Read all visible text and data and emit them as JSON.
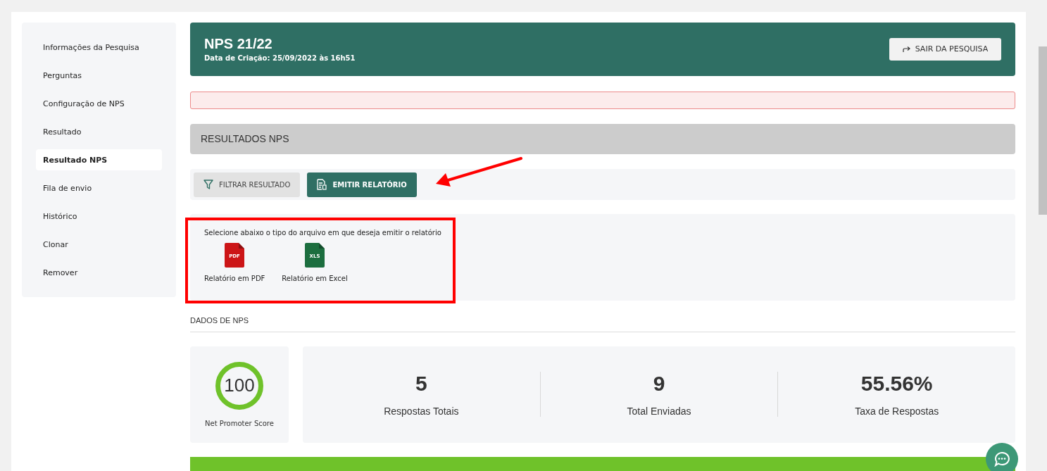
{
  "sidebar": {
    "items": [
      {
        "label": "Informações da Pesquisa",
        "selected": false
      },
      {
        "label": "Perguntas",
        "selected": false
      },
      {
        "label": "Configuração de NPS",
        "selected": false
      },
      {
        "label": "Resultado",
        "selected": false
      },
      {
        "label": "Resultado NPS",
        "selected": true
      },
      {
        "label": "Fila de envio",
        "selected": false
      },
      {
        "label": "Histórico",
        "selected": false
      },
      {
        "label": "Clonar",
        "selected": false
      },
      {
        "label": "Remover",
        "selected": false
      }
    ]
  },
  "header": {
    "title": "NPS 21/22",
    "subtitle": "Data de Criação: 25/09/2022 às 16h51",
    "exit_button": "SAIR DA PESQUISA"
  },
  "section_title": "RESULTADOS NPS",
  "toolbar": {
    "buttons": [
      {
        "label": "FILTRAR RESULTADO",
        "kind": "filter",
        "selected": false
      },
      {
        "label": "EMITIR RELATÓRIO",
        "kind": "report",
        "selected": true
      }
    ]
  },
  "report_panel": {
    "prompt": "Selecione abaixo o tipo do arquivo em que deseja emitir o relatório",
    "options": [
      {
        "label": "Relatório em PDF",
        "kind": "pdf",
        "badge": "PDF"
      },
      {
        "label": "Relatório em Excel",
        "kind": "xls",
        "badge": "XLS"
      }
    ]
  },
  "nps_data": {
    "heading": "DADOS DE NPS",
    "score": {
      "value": "100",
      "label": "Net Promoter Score"
    },
    "stats": [
      {
        "value": "5",
        "label": "Respostas Totais"
      },
      {
        "value": "9",
        "label": "Total Enviadas"
      },
      {
        "value": "55.56%",
        "label": "Taxa de Respostas"
      }
    ]
  }
}
